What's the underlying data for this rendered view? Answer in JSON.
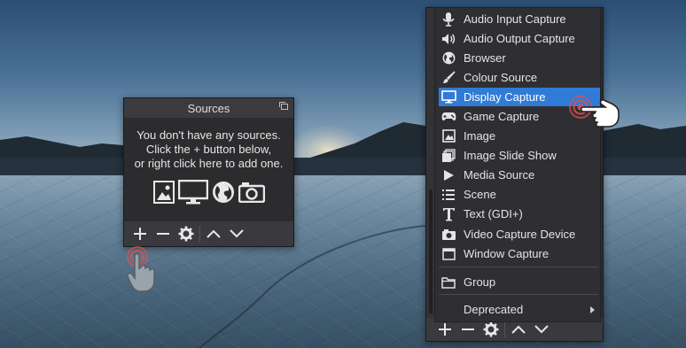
{
  "sources_dock": {
    "title": "Sources",
    "empty_message_line1": "You don't have any sources.",
    "empty_message_line2": "Click the + button below,",
    "empty_message_line3": "or right click here to add one."
  },
  "toolbar": {
    "icons": [
      "plus-icon",
      "minus-icon",
      "gear-icon",
      "chevron-up-icon",
      "chevron-down-icon"
    ]
  },
  "add_source_menu": {
    "items": [
      {
        "label": "Audio Input Capture",
        "icon": "microphone-icon"
      },
      {
        "label": "Audio Output Capture",
        "icon": "speaker-icon"
      },
      {
        "label": "Browser",
        "icon": "globe-icon"
      },
      {
        "label": "Colour Source",
        "icon": "brush-icon"
      },
      {
        "label": "Display Capture",
        "icon": "monitor-icon",
        "selected": true
      },
      {
        "label": "Game Capture",
        "icon": "gamepad-icon"
      },
      {
        "label": "Image",
        "icon": "image-icon"
      },
      {
        "label": "Image Slide Show",
        "icon": "slideshow-icon"
      },
      {
        "label": "Media Source",
        "icon": "play-icon"
      },
      {
        "label": "Scene",
        "icon": "list-icon"
      },
      {
        "label": "Text (GDI+)",
        "icon": "text-icon"
      },
      {
        "label": "Video Capture Device",
        "icon": "camera-icon"
      },
      {
        "label": "Window Capture",
        "icon": "window-icon"
      },
      {
        "label": "Group",
        "icon": "folder-icon"
      },
      {
        "label": "Deprecated",
        "icon": "",
        "submenu": true
      }
    ]
  },
  "colors": {
    "panel_bg": "#2c2c2f",
    "selection": "#2f7bd6",
    "text": "#e4e4e4",
    "click_marker": "#e0504f"
  }
}
